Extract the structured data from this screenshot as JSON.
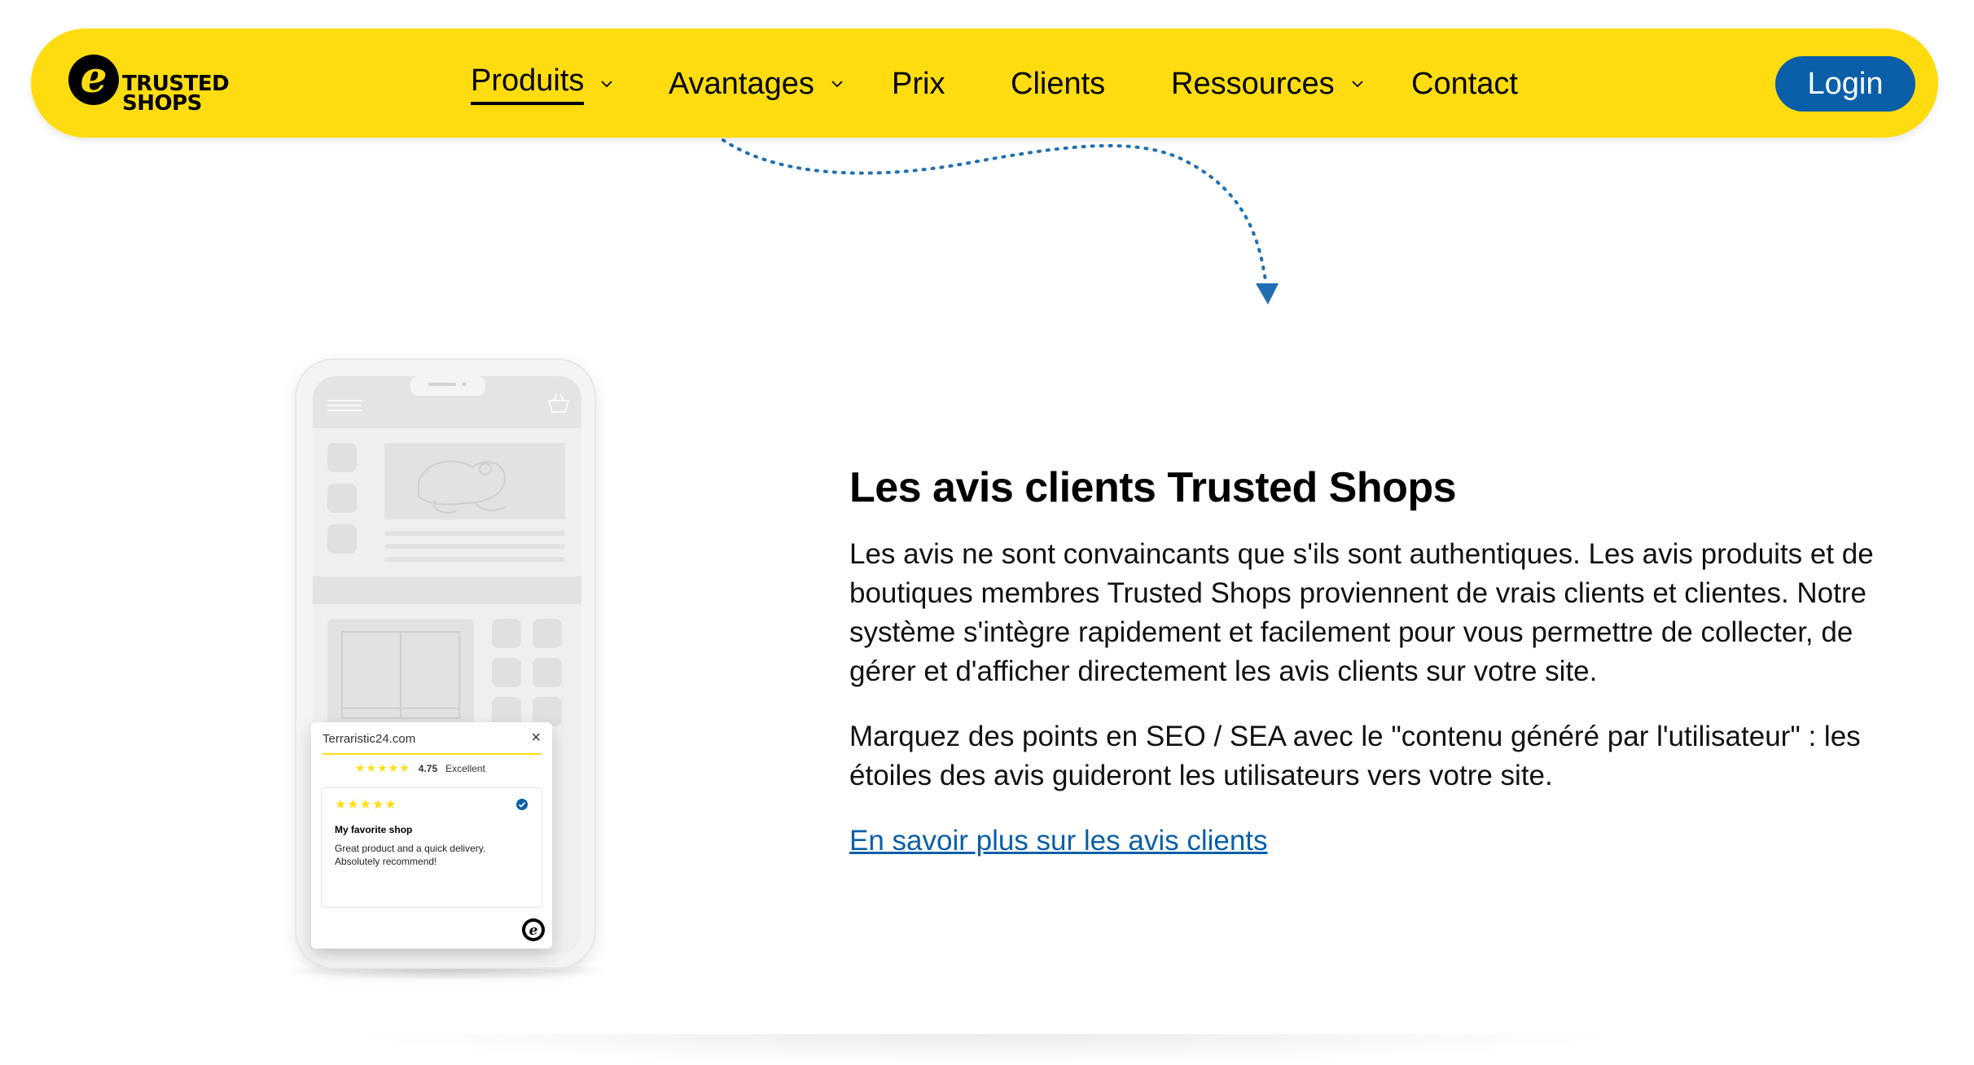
{
  "nav": {
    "logo_mark": "e",
    "logo_text_line1": "TRUSTED",
    "logo_text_line2": "SHOPS",
    "items": [
      {
        "label": "Produits",
        "has_dropdown": true,
        "active": true
      },
      {
        "label": "Avantages",
        "has_dropdown": true,
        "active": false
      },
      {
        "label": "Prix",
        "has_dropdown": false,
        "active": false
      },
      {
        "label": "Clients",
        "has_dropdown": false,
        "active": false
      },
      {
        "label": "Ressources",
        "has_dropdown": true,
        "active": false
      },
      {
        "label": "Contact",
        "has_dropdown": false,
        "active": false
      }
    ],
    "login_label": "Login"
  },
  "phone": {
    "review_widget": {
      "shop_name": "Terraristic24.com",
      "close_glyph": "×",
      "summary_stars": "★★★★★",
      "rating": "4.75",
      "rating_label": "Excellent",
      "review_stars": "★★★★★",
      "review_title": "My favorite shop",
      "review_text": "Great product and a quick delivery. Absolutely recommend!"
    }
  },
  "content": {
    "heading": "Les avis clients Trusted Shops",
    "paragraph1": "Les avis ne sont convaincants que s'ils sont authentiques. Les avis produits et de boutiques membres Trusted Shops proviennent de vrais clients et clientes. Notre système s'intègre rapidement et facilement pour vous permettre de collecter, de gérer et d'afficher directement les avis clients sur votre site.",
    "paragraph2": "Marquez des points en SEO / SEA avec le \"contenu généré par l'utilisateur\" : les étoiles des avis guideront les utilisateurs vers votre site.",
    "link": "En savoir plus sur les avis clients"
  },
  "colors": {
    "brand_yellow": "#ffdc0f",
    "login_blue": "#0a5fa8",
    "link_blue": "#0a5fa8",
    "arrow_blue": "#1f6fb2"
  },
  "icons": [
    "chevron-down-icon",
    "close-icon",
    "verified-check-icon",
    "cart-icon",
    "menu-icon",
    "trusted-shops-badge-icon",
    "curved-dotted-arrow"
  ]
}
